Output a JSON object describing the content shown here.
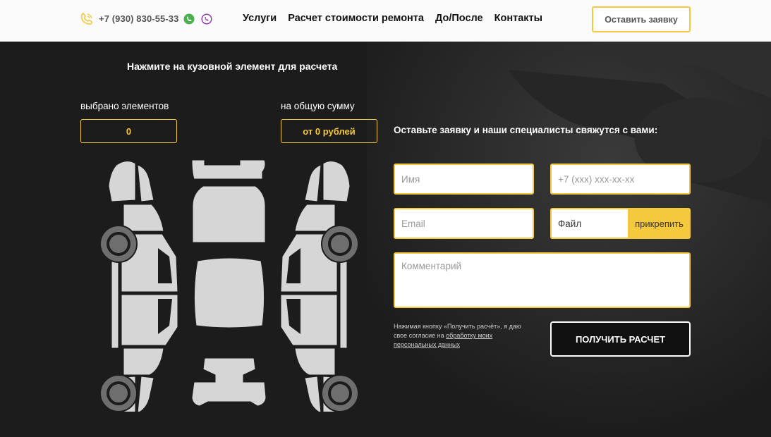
{
  "header": {
    "phone": "+7 (930) 830-55-33",
    "nav": [
      "Услуги",
      "Расчет стоимости ремонта",
      "До/После",
      "Контакты"
    ],
    "request_button": "Оставить заявку",
    "icons": [
      "phone-icon",
      "whatsapp-icon",
      "viber-icon"
    ]
  },
  "calculator": {
    "title": "Нажмите на кузовной элемент для расчета",
    "count_label": "выбрано элементов",
    "count_value": "0",
    "sum_label": "на общую сумму",
    "sum_value": "от 0 рублей"
  },
  "form": {
    "title": "Оставьте заявку и наши специалисты свяжутся с вами:",
    "name_placeholder": "Имя",
    "phone_placeholder": "+7 (xxx) xxx-xx-xx",
    "email_placeholder": "Email",
    "file_label": "Файл",
    "file_button": "прикрепить",
    "comment_placeholder": "Комментарий",
    "consent_text": "Нажимая кнопку «Получить расчёт», я даю свое согласие на ",
    "consent_link": "обработку моих персональных данных",
    "submit": "ПОЛУЧИТЬ РАСЧЕТ"
  },
  "colors": {
    "accent": "#f5c93d",
    "background": "#1c1c1c",
    "header_bg": "#fbfbfb",
    "car_part": "#d6d6d6",
    "wheel": "#6e6e6e"
  }
}
